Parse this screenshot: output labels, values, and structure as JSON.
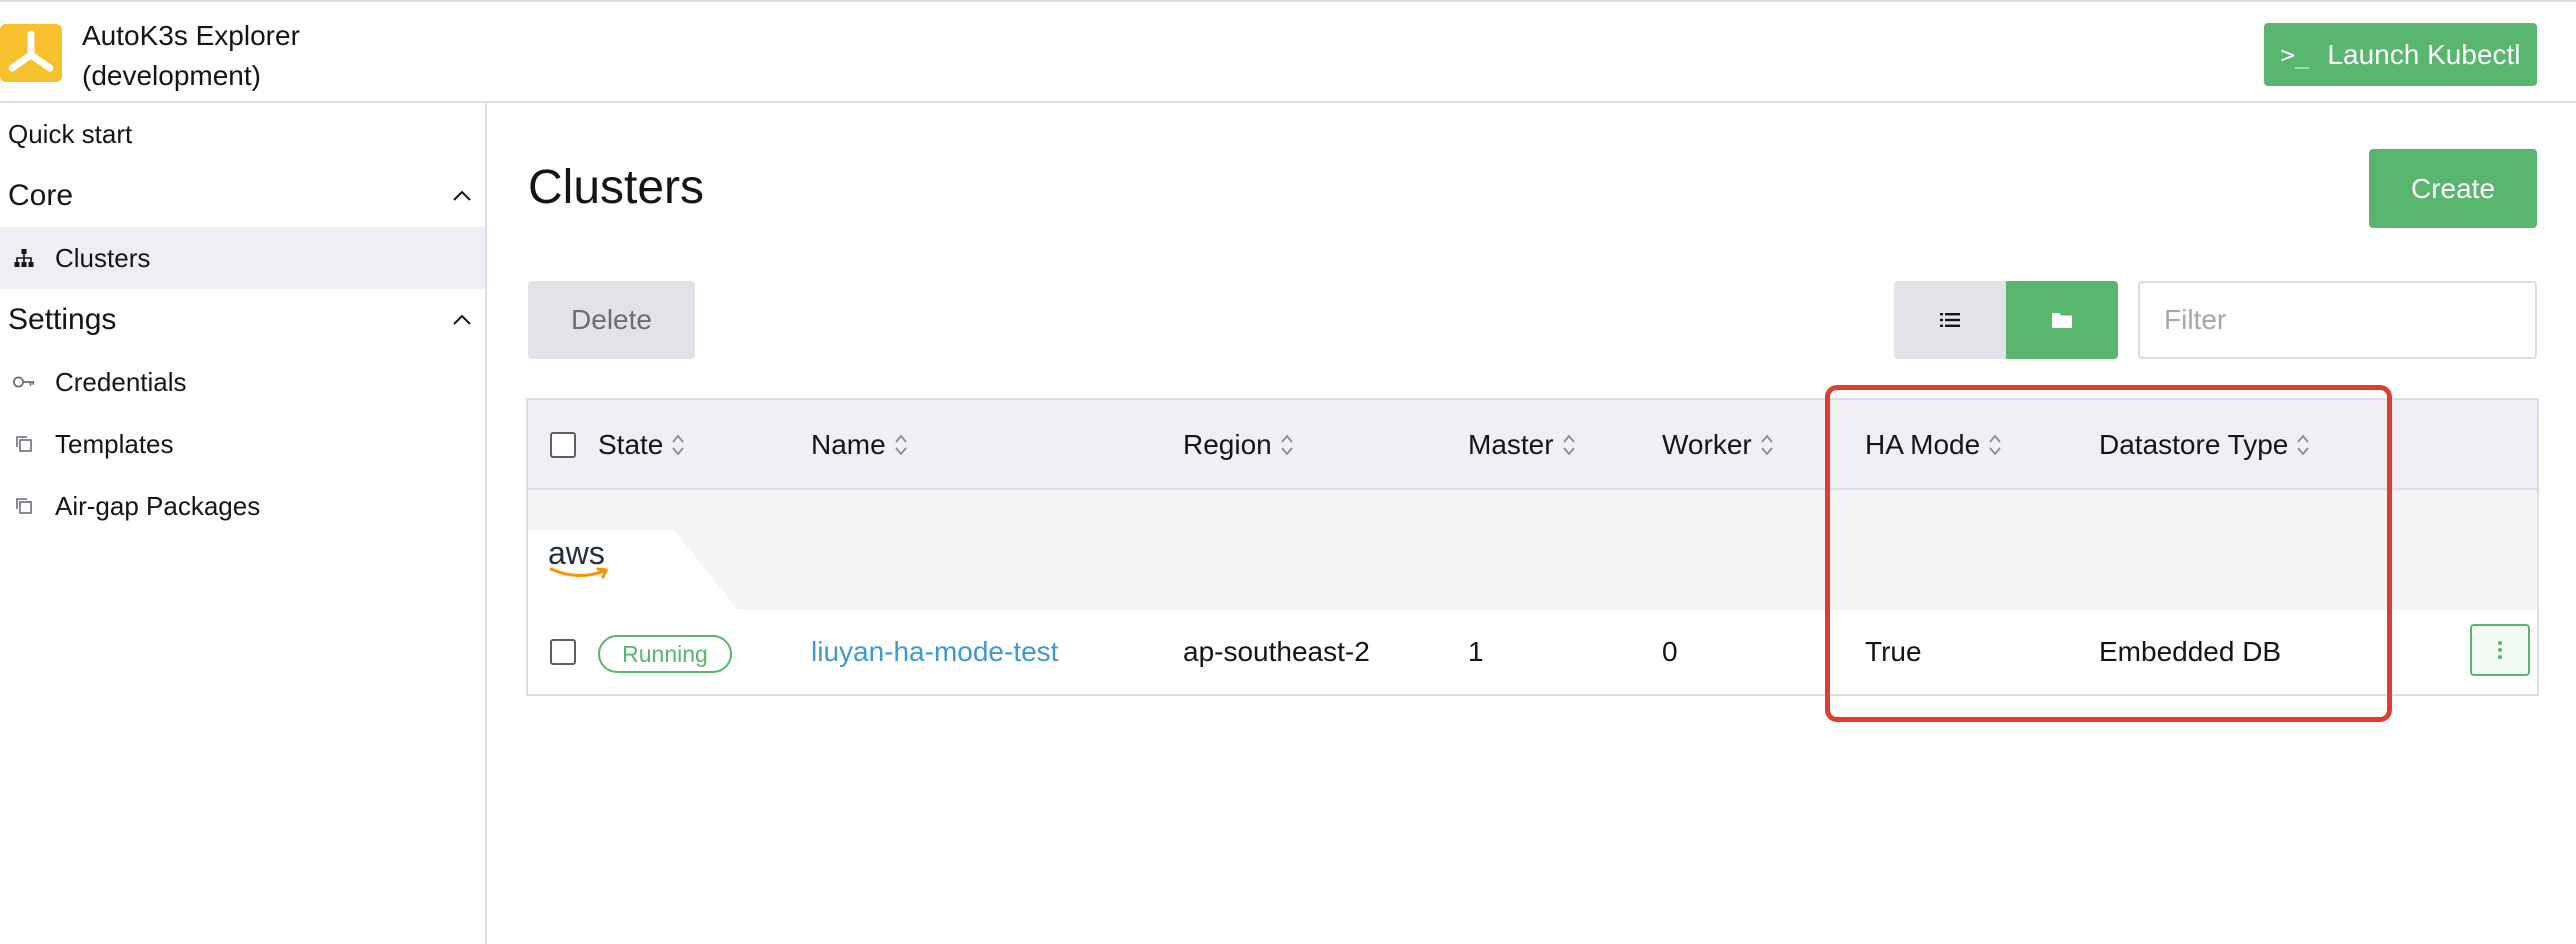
{
  "header": {
    "title_line1": "AutoK3s Explorer",
    "title_line2": "(development)",
    "launch_prompt": ">_",
    "launch_label": "Launch Kubectl"
  },
  "sidebar": {
    "quick_start": "Quick start",
    "groups": [
      {
        "label": "Core",
        "items": [
          {
            "label": "Clusters",
            "icon": "cluster-tree-icon",
            "active": true
          }
        ]
      },
      {
        "label": "Settings",
        "items": [
          {
            "label": "Credentials",
            "icon": "key-icon"
          },
          {
            "label": "Templates",
            "icon": "copy-icon"
          },
          {
            "label": "Air-gap Packages",
            "icon": "copy-icon"
          }
        ]
      }
    ]
  },
  "main": {
    "title": "Clusters",
    "create_label": "Create",
    "delete_label": "Delete",
    "filter_placeholder": "Filter",
    "view_modes": [
      "list-icon",
      "folder-icon"
    ],
    "table": {
      "columns": [
        "State",
        "Name",
        "Region",
        "Master",
        "Worker",
        "HA Mode",
        "Datastore Type"
      ],
      "groups": [
        {
          "provider": "aws",
          "rows": [
            {
              "state": "Running",
              "name": "liuyan-ha-mode-test",
              "region": "ap-southeast-2",
              "master": "1",
              "worker": "0",
              "ha_mode": "True",
              "datastore_type": "Embedded DB"
            }
          ]
        }
      ]
    }
  },
  "colors": {
    "accent_green": "#58b66f",
    "link_blue": "#3d98d3",
    "highlight_red": "#e23b30",
    "logo_yellow": "#f7c12e",
    "aws_orange": "#f79400"
  }
}
